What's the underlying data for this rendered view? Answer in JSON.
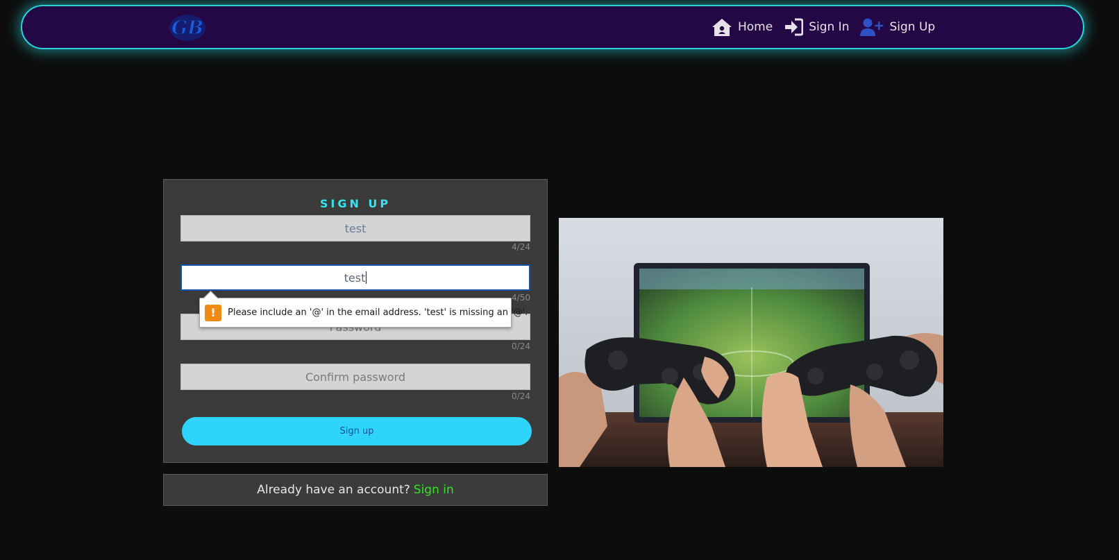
{
  "nav": {
    "logo_text": "GB",
    "home": "Home",
    "sign_in": "Sign In",
    "sign_up": "Sign Up"
  },
  "form": {
    "title": "SIGN UP",
    "username": {
      "value": "test",
      "counter": "4/24"
    },
    "email": {
      "value": "test",
      "counter": "4/50"
    },
    "password": {
      "placeholder": "Password",
      "counter": "0/24"
    },
    "confirm": {
      "placeholder": "Confirm password",
      "counter": "0/24"
    },
    "submit_label": "Sign up"
  },
  "validation": {
    "message": "Please include an '@' in the email address. 'test' is missing an '@'.",
    "icon": "!"
  },
  "signin_prompt": {
    "text": "Already have an account?",
    "link": "Sign in"
  },
  "colors": {
    "nav_bg": "#230845",
    "nav_glow": "#2ad4d8",
    "title_accent": "#35e5ef",
    "button": "#2ed4fb",
    "link_green": "#33e625",
    "warning": "#f08a10"
  }
}
